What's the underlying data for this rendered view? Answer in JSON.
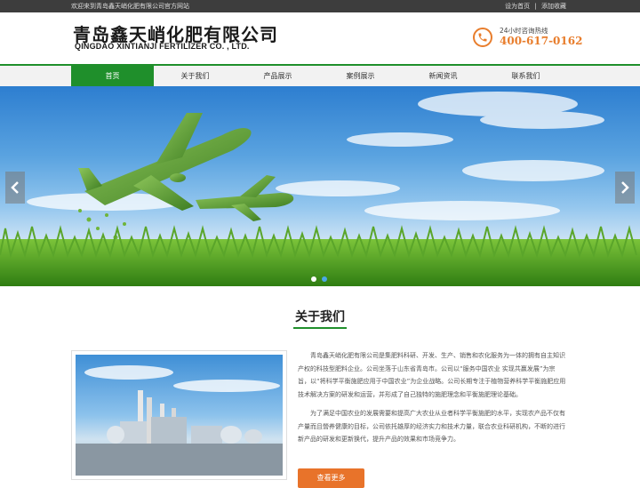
{
  "topbar": {
    "welcome": "欢迎来到青岛鑫天峭化肥有限公司官方网站",
    "set_home": "设为首页",
    "separator": "|",
    "add_fav": "添加收藏"
  },
  "header": {
    "logo_cn": "青岛鑫天峭化肥有限公司",
    "logo_en": "QINGDAO XINTIANJI FERTILIZER CO. , LTD.",
    "hotline_label": "24小时咨询热线",
    "hotline_number": "400-617-0162",
    "icon": "phone-icon",
    "accent_color": "#e87d2c"
  },
  "nav": {
    "items": [
      {
        "label": "首页",
        "active": true
      },
      {
        "label": "关于我们",
        "active": false
      },
      {
        "label": "产品展示",
        "active": false
      },
      {
        "label": "案例展示",
        "active": false
      },
      {
        "label": "新闻资讯",
        "active": false
      },
      {
        "label": "联系我们",
        "active": false
      }
    ],
    "active_color": "#1f8f2b"
  },
  "banner": {
    "slide_count": 2,
    "active_slide": 1,
    "prev_icon": "chevron-left-icon",
    "next_icon": "chevron-right-icon"
  },
  "about": {
    "title": "关于我们",
    "paragraphs": [
      "青岛鑫天峭化肥有限公司是集肥料科研、开发、生产、销售和农化服务为一体的拥有自主知识产权的科技型肥料企业。公司坐落于山东省青岛市。公司以“服务中国农业 实现共赢发展”为宗旨，以“将科学平衡施肥应用于中国农业”为企业战略。公司长期专注于植物营养科学平衡施肥应用技术解决方案的研发和运营，并形成了自己独特的施肥理念和平衡施肥理论基础。",
      "为了满足中国农业的发展需要和提高广大农业从业者科学平衡施肥的水平，实现农产品不仅有产量而且營养健康的目标，公司依托雄厚的经济实力和技术力量，联合农业科研机构，不断的进行新产品的研发和更新换代，提升产品的效果和市场竞争力。"
    ],
    "more_label": "查看更多",
    "button_color": "#e8732a"
  }
}
